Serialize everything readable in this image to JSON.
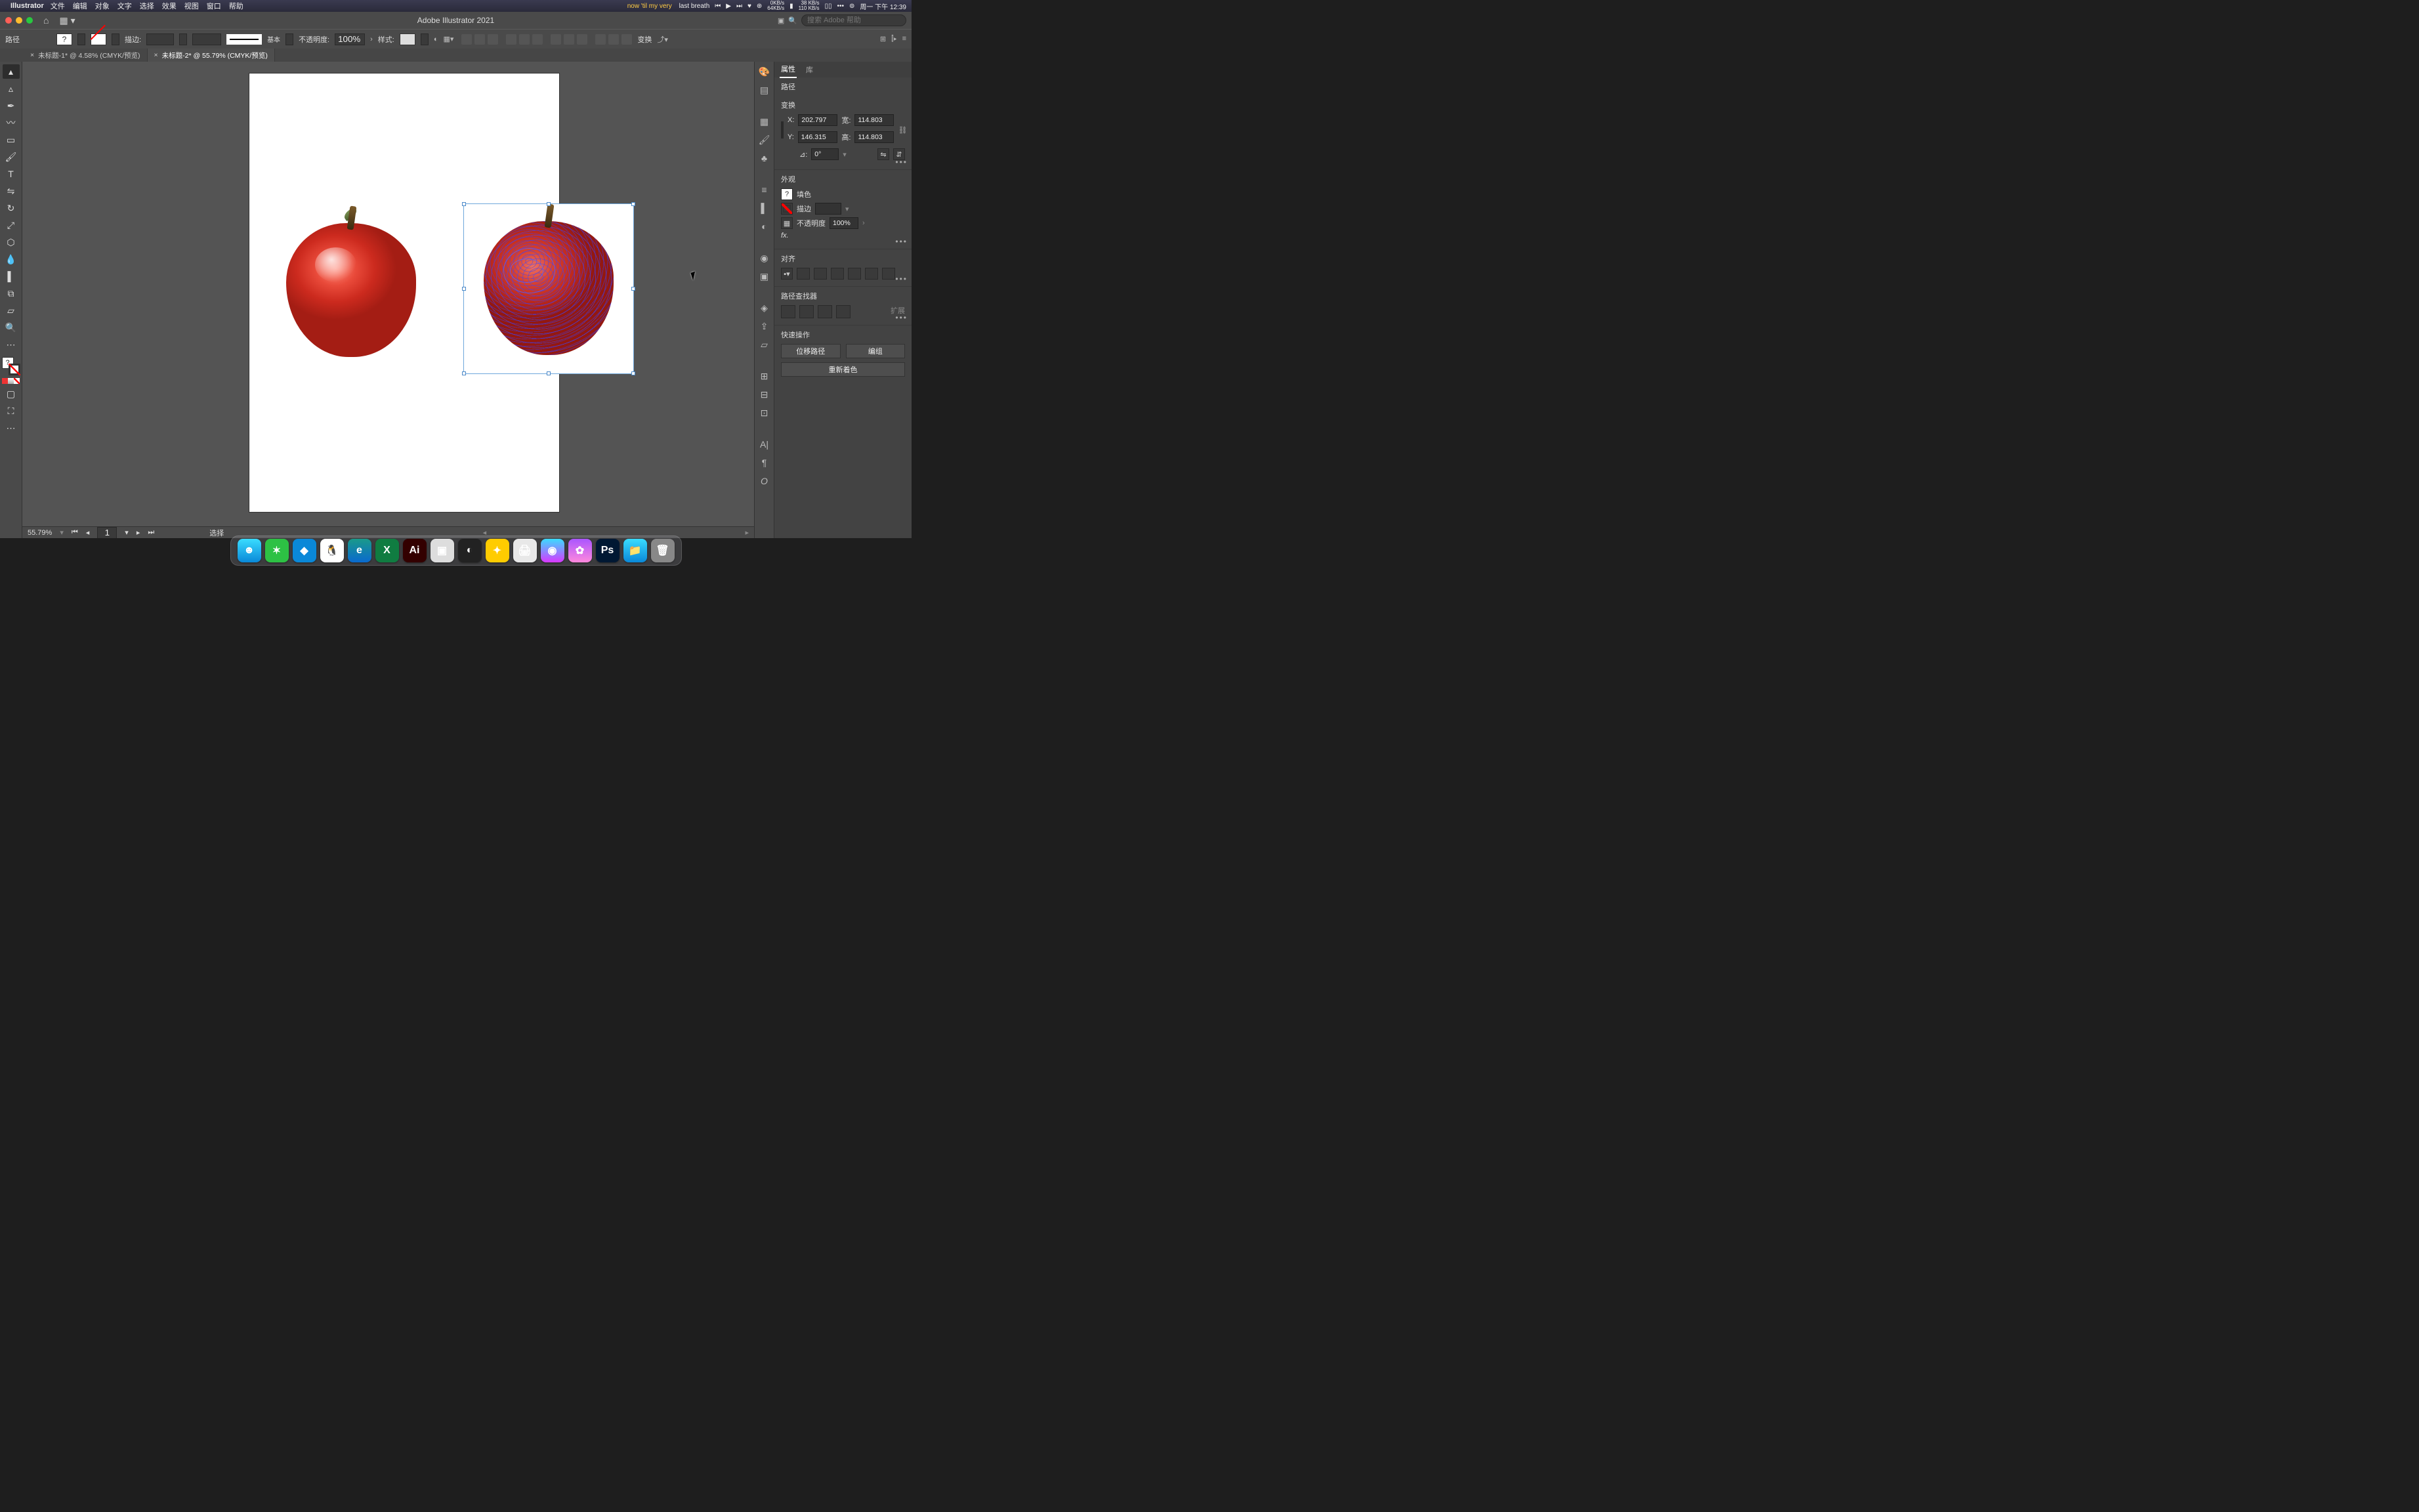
{
  "mac_menu": {
    "app_name": "Illustrator",
    "items": [
      "文件",
      "编辑",
      "对象",
      "文字",
      "选择",
      "效果",
      "视图",
      "窗口",
      "帮助"
    ],
    "now_playing_prefix": "now 'til my very",
    "now_playing_suffix": "last breath",
    "net_stats_top": "0KB/s",
    "net_stats_bot": "64KB/s",
    "disk_stats_top": "38 KB/s",
    "disk_stats_bot": "110 KB/s",
    "lang": "周一 下午 12:39"
  },
  "titlebar": {
    "title": "Adobe Illustrator 2021",
    "search_placeholder": "搜索 Adobe 帮助"
  },
  "controlbar": {
    "selection_type": "路径",
    "stroke_label": "描边:",
    "stroke_style_label": "基本",
    "opacity_label": "不透明度:",
    "opacity_value": "100%",
    "style_label": "样式:",
    "transform_label": "变换"
  },
  "tabs": [
    {
      "label": "未标题-1* @ 4.58% (CMYK/预览)",
      "active": false
    },
    {
      "label": "未标题-2* @ 55.79% (CMYK/预览)",
      "active": true
    }
  ],
  "status": {
    "zoom": "55.79%",
    "artboard": "1",
    "mode": "选择"
  },
  "properties": {
    "tab_props": "属性",
    "tab_lib": "库",
    "object_type": "路径",
    "transform": {
      "header": "变换",
      "x_label": "X:",
      "x": "202.797",
      "y_label": "Y:",
      "y": "146.315",
      "w_label": "宽:",
      "w": "114.803",
      "h_label": "高:",
      "h": "114.803",
      "angle_label": "⊿:",
      "angle": "0°"
    },
    "appearance": {
      "header": "外观",
      "fill_label": "填色",
      "stroke_label": "描边",
      "opacity_label": "不透明度",
      "opacity_value": "100%",
      "fx_label": "fx."
    },
    "align": {
      "header": "对齐"
    },
    "pathfinder": {
      "header": "路径查找器",
      "expand_label": "扩展"
    },
    "quick": {
      "header": "快速操作",
      "offset": "位移路径",
      "group": "编组",
      "recolor": "重新着色"
    }
  },
  "dock_apps": [
    "Finder",
    "WeChat",
    "DingTalk",
    "QQ",
    "Edge",
    "Excel",
    "Illustrator",
    "Preview",
    "C4D",
    "App1",
    "App2",
    "App3",
    "App4",
    "Photoshop",
    "Folder",
    "Trash"
  ]
}
